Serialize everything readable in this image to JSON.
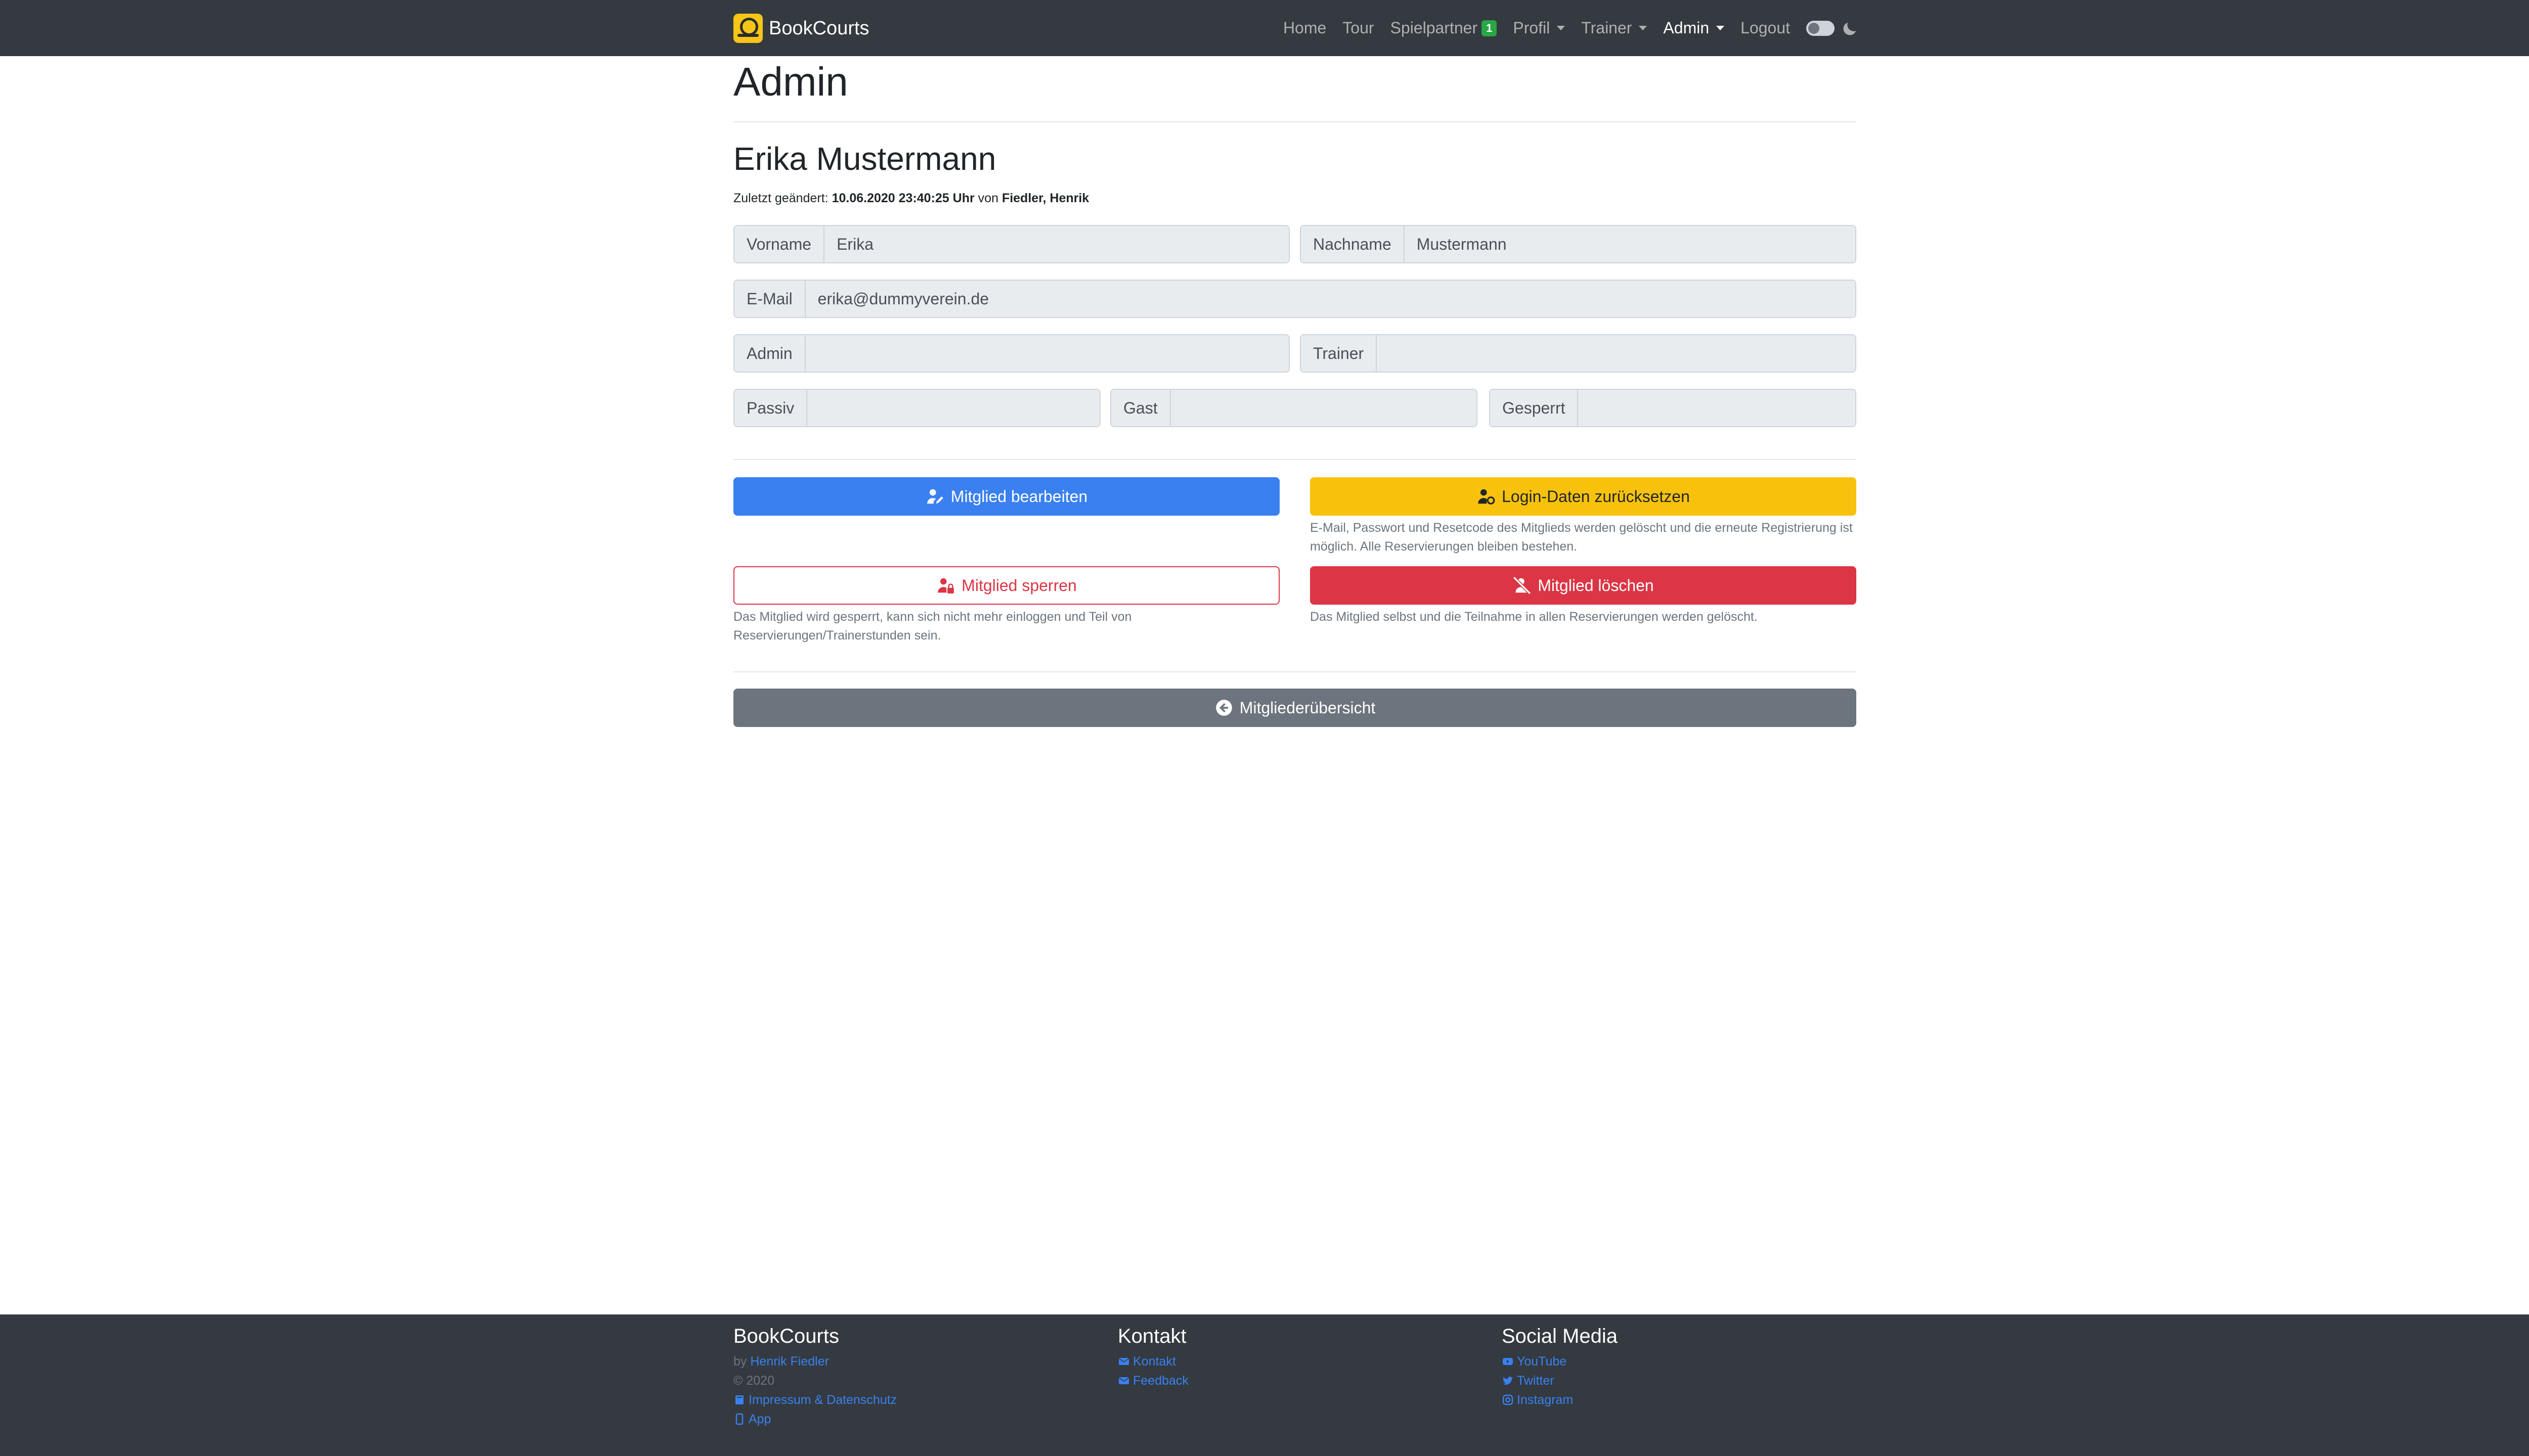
{
  "brand": {
    "name": "BookCourts"
  },
  "nav": {
    "home": "Home",
    "tour": "Tour",
    "spielpartner": "Spielpartner",
    "spielpartner_badge": "1",
    "profil": "Profil",
    "trainer": "Trainer",
    "admin": "Admin",
    "logout": "Logout"
  },
  "page": {
    "title": "Admin"
  },
  "member": {
    "name": "Erika Mustermann",
    "changed_label": "Zuletzt geändert: ",
    "changed_time": "10.06.2020 23:40:25 Uhr",
    "changed_by_label": " von ",
    "changed_by": "Fiedler, Henrik"
  },
  "form": {
    "vorname_label": "Vorname",
    "vorname_value": "Erika",
    "nachname_label": "Nachname",
    "nachname_value": "Mustermann",
    "email_label": "E-Mail",
    "email_value": "erika@dummyverein.de",
    "admin_label": "Admin",
    "admin_value": "",
    "trainer_label": "Trainer",
    "trainer_value": "",
    "passiv_label": "Passiv",
    "passiv_value": "",
    "gast_label": "Gast",
    "gast_value": "",
    "gesperrt_label": "Gesperrt",
    "gesperrt_value": ""
  },
  "actions": {
    "edit": "Mitglied bearbeiten",
    "reset": "Login-Daten zurücksetzen",
    "reset_help": "E-Mail, Passwort und Resetcode des Mitglieds werden gelöscht und die erneute Registrierung ist möglich. Alle Reservierungen bleiben bestehen.",
    "lock": "Mitglied sperren",
    "lock_help": "Das Mitglied wird gesperrt, kann sich nicht mehr einloggen und Teil von Reservierungen/Trainerstunden sein.",
    "delete": "Mitglied löschen",
    "delete_help": "Das Mitglied selbst und die Teilnahme in allen Reservierungen werden gelöscht.",
    "overview": "Mitgliederübersicht"
  },
  "footer": {
    "col1_title": "BookCourts",
    "by_label": "by ",
    "author": "Henrik Fiedler",
    "copyright": "© 2020",
    "impressum": "Impressum & Datenschutz",
    "app": "App",
    "col2_title": "Kontakt",
    "kontakt": "Kontakt",
    "feedback": "Feedback",
    "col3_title": "Social Media",
    "youtube": "YouTube",
    "twitter": "Twitter",
    "instagram": "Instagram"
  },
  "colors": {
    "navbar": "#343a40",
    "primary": "#3a80f0",
    "warning": "#f8c20c",
    "danger": "#dc3545",
    "secondary": "#6c757d",
    "badge": "#28a745"
  },
  "icons": [
    "user-edit-icon",
    "user-lock-icon",
    "user-slash-icon",
    "user-reset-icon",
    "arrow-circle-left-icon",
    "moon-icon",
    "envelope-icon",
    "youtube-icon",
    "twitter-icon",
    "instagram-icon",
    "book-icon",
    "mobile-icon"
  ]
}
